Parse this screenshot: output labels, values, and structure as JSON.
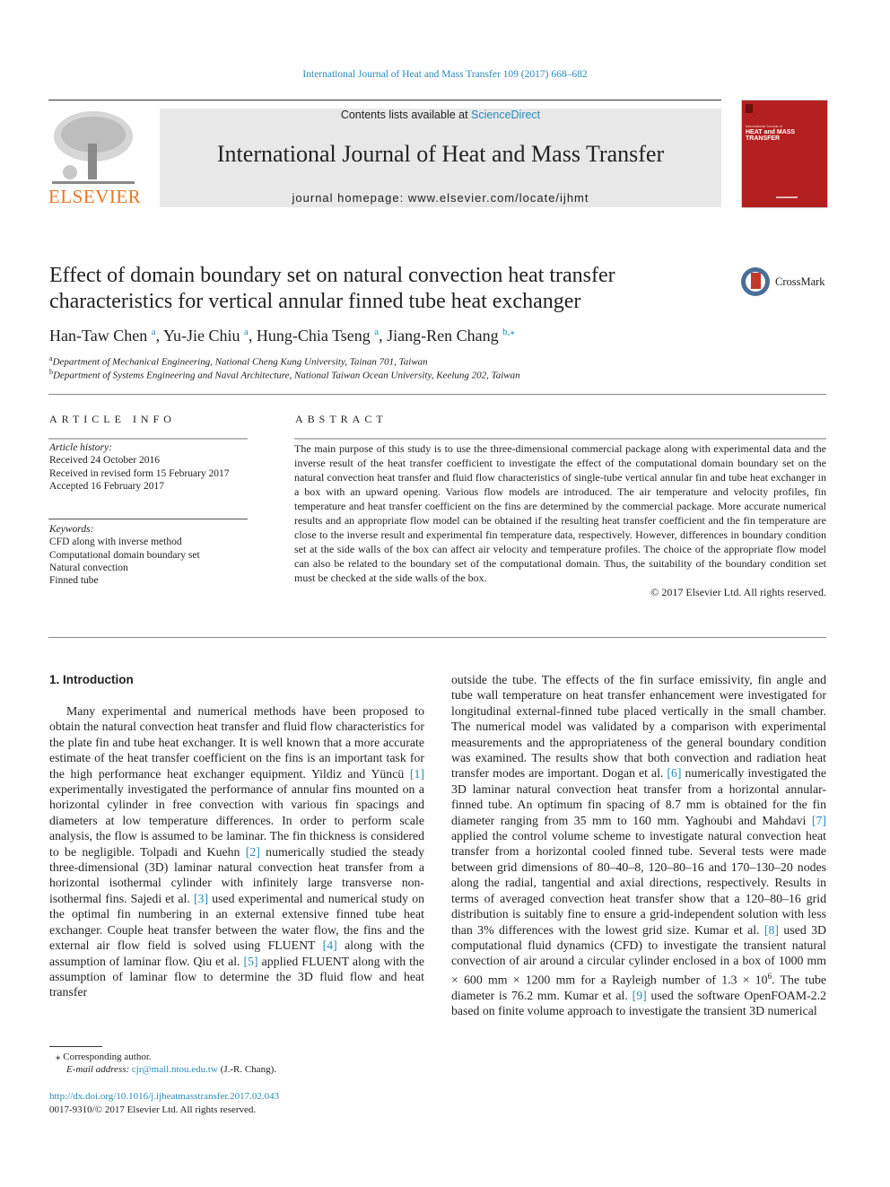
{
  "citation": "International Journal of Heat and Mass Transfer 109 (2017) 668–682",
  "header": {
    "publisher": "ELSEVIER",
    "contents_prefix": "Contents lists available at ",
    "contents_link": "ScienceDirect",
    "journal_title": "International Journal of Heat and Mass Transfer",
    "homepage": "journal homepage: www.elsevier.com/locate/ijhmt",
    "cover": {
      "small": "International Journal of",
      "big_line1": "HEAT and MASS",
      "big_line2": "TRANSFER",
      "color": "#b41f1f"
    }
  },
  "article": {
    "title": "Effect of domain boundary set on natural convection heat transfer characteristics for vertical annular finned tube heat exchanger",
    "crossmark": "CrossMark",
    "authors": [
      {
        "name": "Han-Taw Chen",
        "sup": "a"
      },
      {
        "name": "Yu-Jie Chiu",
        "sup": "a"
      },
      {
        "name": "Hung-Chia Tseng",
        "sup": "a"
      },
      {
        "name": "Jiang-Ren Chang",
        "sup": "b,⁎"
      }
    ],
    "affiliations": [
      {
        "sup": "a",
        "text": "Department of Mechanical Engineering, National Cheng Kung University, Tainan 701, Taiwan"
      },
      {
        "sup": "b",
        "text": "Department of Systems Engineering and Naval Architecture, National Taiwan Ocean University, Keelung 202, Taiwan"
      }
    ]
  },
  "article_info": {
    "heading": "ARTICLE INFO",
    "history_label": "Article history:",
    "history": [
      "Received 24 October 2016",
      "Received in revised form 15 February 2017",
      "Accepted 16 February 2017"
    ],
    "keywords_label": "Keywords:",
    "keywords": [
      "CFD along with inverse method",
      "Computational domain boundary set",
      "Natural convection",
      "Finned tube"
    ]
  },
  "abstract": {
    "heading": "ABSTRACT",
    "text": "The main purpose of this study is to use the three-dimensional commercial package along with experimental data and the inverse result of the heat transfer coefficient to investigate the effect of the computational domain boundary set on the natural convection heat transfer and fluid flow characteristics of single-tube vertical annular fin and tube heat exchanger in a box with an upward opening. Various flow models are introduced. The air temperature and velocity profiles, fin temperature and heat transfer coefficient on the fins are determined by the commercial package. More accurate numerical results and an appropriate flow model can be obtained if the resulting heat transfer coefficient and the fin temperature are close to the inverse result and experimental fin temperature data, respectively. However, differences in boundary condition set at the side walls of the box can affect air velocity and temperature profiles. The choice of the appropriate flow model can also be related to the boundary set of the computational domain. Thus, the suitability of the boundary condition set must be checked at the side walls of the box.",
    "copyright": "© 2017 Elsevier Ltd. All rights reserved."
  },
  "intro": {
    "heading": "1. Introduction",
    "left": [
      {
        "t": "Many experimental and numerical methods have been proposed to obtain the natural convection heat transfer and fluid flow characteristics for the plate fin and tube heat exchanger. It is well known that a more accurate estimate of the heat transfer coefficient on the fins is an important task for the high performance heat exchanger equipment. Yildiz and Yüncü "
      },
      {
        "ref": "[1]"
      },
      {
        "t": " experimentally investigated the performance of annular fins mounted on a horizontal cylinder in free convection with various fin spacings and diameters at low temperature differences. In order to perform scale analysis, the flow is assumed to be laminar. The fin thickness is considered to be negligible. Tolpadi and Kuehn "
      },
      {
        "ref": "[2]"
      },
      {
        "t": " numerically studied the steady three-dimensional (3D) laminar natural convection heat transfer from a horizontal isothermal cylinder with infinitely large transverse non-isothermal fins. Sajedi et al. "
      },
      {
        "ref": "[3]"
      },
      {
        "t": " used experimental and numerical study on the optimal fin numbering in an external extensive finned tube heat exchanger. Couple heat transfer between the water flow, the fins and the external air flow field is solved using FLUENT "
      },
      {
        "ref": "[4]"
      },
      {
        "t": " along with the assumption of laminar flow. Qiu et al. "
      },
      {
        "ref": "[5]"
      },
      {
        "t": " applied FLUENT along with the assumption of laminar flow to determine the 3D fluid flow and heat transfer"
      }
    ],
    "right": [
      {
        "t": "outside the tube. The effects of the fin surface emissivity, fin angle and tube wall temperature on heat transfer enhancement were investigated for longitudinal external-finned tube placed vertically in the small chamber. The numerical model was validated by a comparison with experimental measurements and the appropriateness of the general boundary condition was examined. The results show that both convection and radiation heat transfer modes are important. Dogan et al. "
      },
      {
        "ref": "[6]"
      },
      {
        "t": " numerically investigated the 3D laminar natural convection heat transfer from a horizontal annular-finned tube. An optimum fin spacing of 8.7 mm is obtained for the fin diameter ranging from 35 mm to 160 mm. Yaghoubi and Mahdavi "
      },
      {
        "ref": "[7]"
      },
      {
        "t": " applied the control volume scheme to investigate natural convection heat transfer from a horizontal cooled finned tube. Several tests were made between grid dimensions of 80–40–8, 120–80–16 and 170–130–20 nodes along the radial, tangential and axial directions, respectively. Results in terms of averaged convection heat transfer show that a 120–80–16 grid distribution is suitably fine to ensure a grid-independent solution with less than 3% differences with the lowest grid size. Kumar et al. "
      },
      {
        "ref": "[8]"
      },
      {
        "t": " used 3D computational fluid dynamics (CFD) to investigate the transient natural convection of air around a circular cylinder enclosed in a box of 1000 mm × 600 mm × 1200 mm for a Rayleigh number of 1.3 × 10"
      },
      {
        "sup": "6"
      },
      {
        "t": ". The tube diameter is 76.2 mm. Kumar et al. "
      },
      {
        "ref": "[9]"
      },
      {
        "t": " used the software OpenFOAM-2.2 based on finite volume approach to investigate the transient 3D numerical"
      }
    ]
  },
  "footnotes": {
    "corresponding": "⁎ Corresponding author.",
    "email_label": "E-mail address:",
    "email": "cjr@mail.ntou.edu.tw",
    "email_suffix": " (J.-R. Chang).",
    "doi": "http://dx.doi.org/10.1016/j.ijheatmasstransfer.2017.02.043",
    "issn": "0017-9310/© 2017 Elsevier Ltd. All rights reserved."
  }
}
